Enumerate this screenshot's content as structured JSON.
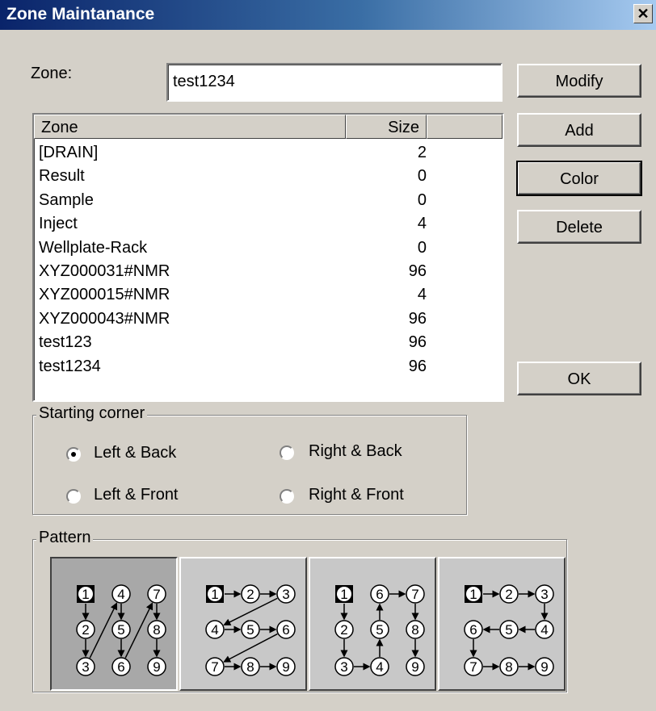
{
  "window": {
    "title": "Zone Maintanance",
    "close_glyph": "✕"
  },
  "zone_field": {
    "label": "Zone:",
    "value": "test1234"
  },
  "buttons": {
    "modify": "Modify",
    "add": "Add",
    "color": "Color",
    "delete": "Delete",
    "ok": "OK"
  },
  "list": {
    "columns": [
      "Zone",
      "Size"
    ],
    "rows": [
      {
        "zone": "[DRAIN]",
        "size": "2"
      },
      {
        "zone": "Result",
        "size": "0"
      },
      {
        "zone": "Sample",
        "size": "0"
      },
      {
        "zone": "Inject",
        "size": "4"
      },
      {
        "zone": "Wellplate-Rack",
        "size": "0"
      },
      {
        "zone": "XYZ000031#NMR",
        "size": "96"
      },
      {
        "zone": "XYZ000015#NMR",
        "size": "4"
      },
      {
        "zone": "XYZ000043#NMR",
        "size": "96"
      },
      {
        "zone": "test123",
        "size": "96"
      },
      {
        "zone": "test1234",
        "size": "96"
      }
    ]
  },
  "starting_corner": {
    "title": "Starting corner",
    "options": [
      {
        "label": "Left & Back",
        "checked": true
      },
      {
        "label": "Right & Back",
        "checked": false
      },
      {
        "label": "Left & Front",
        "checked": false
      },
      {
        "label": "Right & Front",
        "checked": false
      }
    ]
  },
  "pattern": {
    "title": "Pattern",
    "selected_index": 0,
    "patterns": [
      {
        "name": "column-zigzag",
        "grid": [
          [
            "1",
            "4",
            "7"
          ],
          [
            "2",
            "5",
            "8"
          ],
          [
            "3",
            "6",
            "9"
          ]
        ]
      },
      {
        "name": "row-zigzag",
        "grid": [
          [
            "1",
            "2",
            "3"
          ],
          [
            "4",
            "5",
            "6"
          ],
          [
            "7",
            "8",
            "9"
          ]
        ]
      },
      {
        "name": "column-snake",
        "grid": [
          [
            "1",
            "6",
            "7"
          ],
          [
            "2",
            "5",
            "8"
          ],
          [
            "3",
            "4",
            "9"
          ]
        ]
      },
      {
        "name": "row-snake",
        "grid": [
          [
            "1",
            "2",
            "3"
          ],
          [
            "6",
            "5",
            "4"
          ],
          [
            "7",
            "8",
            "9"
          ]
        ]
      }
    ]
  }
}
